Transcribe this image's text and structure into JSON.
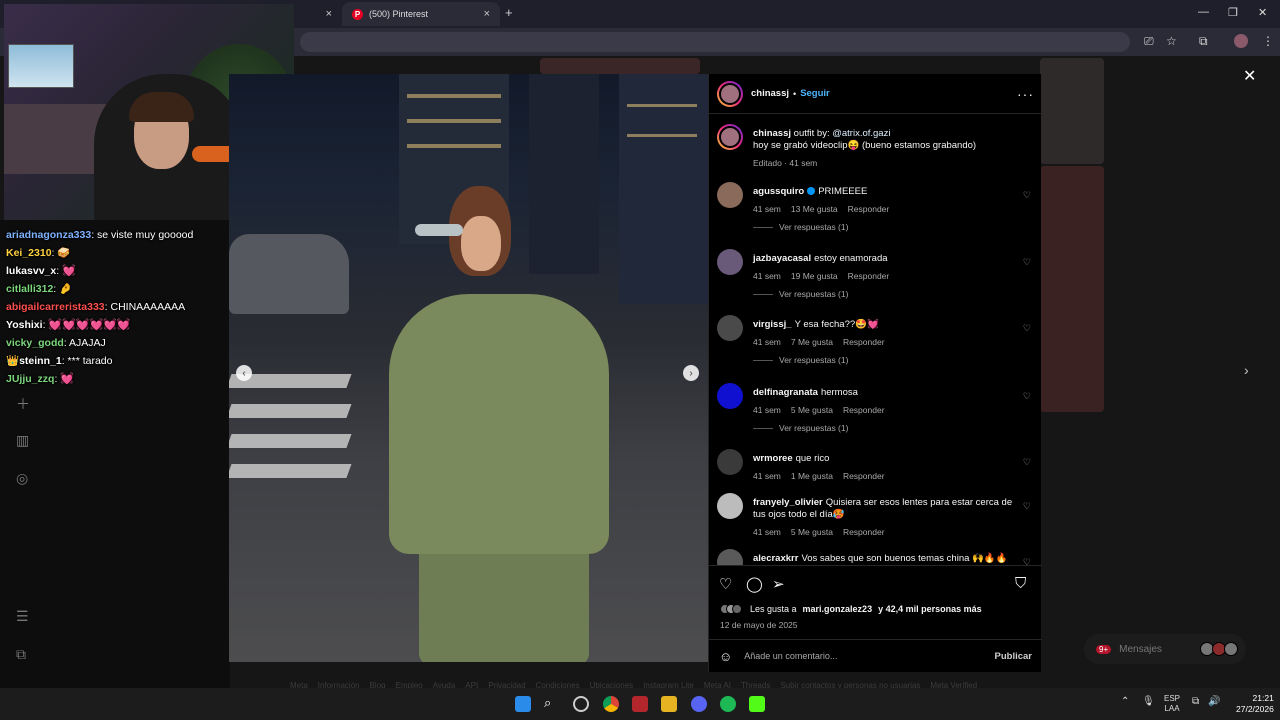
{
  "browser": {
    "tab_title": "(500) Pinterest",
    "tab_close": "×",
    "new_tab": "+"
  },
  "chat": [
    {
      "user": "ariadnagonza333",
      "color": "#7fb2ff",
      "message": "se viste muy gooood"
    },
    {
      "user": "Kei_2310",
      "color": "#ffd23f",
      "message": "🥪"
    },
    {
      "user": "lukasvv_x",
      "color": "#ffffff",
      "message": "💓"
    },
    {
      "user": "citlalli312",
      "color": "#7cd67c",
      "message": "🤌"
    },
    {
      "user": "abigailcarrerista333",
      "color": "#ff4f4f",
      "message": "CHINAAAAAAA"
    },
    {
      "user": "Yoshixi",
      "color": "#ffffff",
      "message": "💓💓💓💓💓💓"
    },
    {
      "user": "vicky_godd",
      "color": "#7cd67c",
      "message": "AJAJAJ"
    },
    {
      "user": "👑steinn_1",
      "color": "#ffffff",
      "message": "*** tarado"
    },
    {
      "user": "JUjju_zzq",
      "color": "#7cd67c",
      "message": "💓"
    }
  ],
  "post": {
    "username": "chinassj",
    "follow_label": "Seguir",
    "separator": "•",
    "more_label": "···",
    "caption_user": "chinassj",
    "caption_prefix": "outfit by:",
    "caption_link": "@atrix.of.gazi",
    "caption_line2": "hoy se grabó videoclip😝 (bueno estamos grabando)",
    "caption_meta": "Editado · 41 sem"
  },
  "comments": [
    {
      "user": "agussquiro",
      "verified": true,
      "text": "PRIMEEEE",
      "time": "41 sem",
      "likes": "13 Me gusta",
      "reply": "Responder",
      "replies": "Ver respuestas (1)",
      "avatar": "#8a6a5a"
    },
    {
      "user": "jazbayacasal",
      "verified": false,
      "text": "estoy enamorada",
      "time": "41 sem",
      "likes": "19 Me gusta",
      "reply": "Responder",
      "replies": "Ver respuestas (1)",
      "avatar": "#6a5a7a"
    },
    {
      "user": "virgissj_",
      "verified": false,
      "text": "Y esa fecha??🤩💓",
      "time": "41 sem",
      "likes": "7 Me gusta",
      "reply": "Responder",
      "replies": "Ver respuestas (1)",
      "avatar": "#4a4a4a"
    },
    {
      "user": "delfinagranata",
      "verified": false,
      "text": "hermosa",
      "time": "41 sem",
      "likes": "5 Me gusta",
      "reply": "Responder",
      "replies": "Ver respuestas (1)",
      "avatar": "#1010d0"
    },
    {
      "user": "wrmoree",
      "verified": false,
      "text": "que rico",
      "time": "41 sem",
      "likes": "1 Me gusta",
      "reply": "Responder",
      "replies": "",
      "avatar": "#3a3a3a"
    },
    {
      "user": "franyely_olivier",
      "verified": false,
      "text": "Quisiera ser esos lentes para estar cerca de tus ojos todo el día🥵",
      "time": "41 sem",
      "likes": "5 Me gusta",
      "reply": "Responder",
      "replies": "",
      "avatar": "#bcbcbc"
    },
    {
      "user": "alecraxkrr",
      "verified": false,
      "text": "Vos sabes que son buenos temas china 🙌🔥🔥",
      "time": "",
      "likes": "",
      "reply": "",
      "replies": "",
      "avatar": "#5a5a5a"
    }
  ],
  "actions": {
    "likes_prefix": "Les gusta a",
    "likes_user": "mari.gonzalez23",
    "likes_suffix": "y 42,4 mil personas más",
    "date": "12 de mayo de 2025",
    "comment_placeholder": "Añade un comentario...",
    "publish_label": "Publicar"
  },
  "background": {
    "messages_label": "Mensajes",
    "messages_badge": "9+",
    "footer_links": [
      "Meta",
      "Información",
      "Blog",
      "Empleo",
      "Ayuda",
      "API",
      "Privacidad",
      "Condiciones",
      "Ubicaciones",
      "Instagram Lite",
      "Meta AI",
      "Threads",
      "Subir contactos y personas no usuarias",
      "Meta Verified"
    ]
  },
  "taskbar": {
    "lang_top": "ESP",
    "lang_bottom": "LAA",
    "time": "21:21",
    "date": "27/2/2026"
  }
}
